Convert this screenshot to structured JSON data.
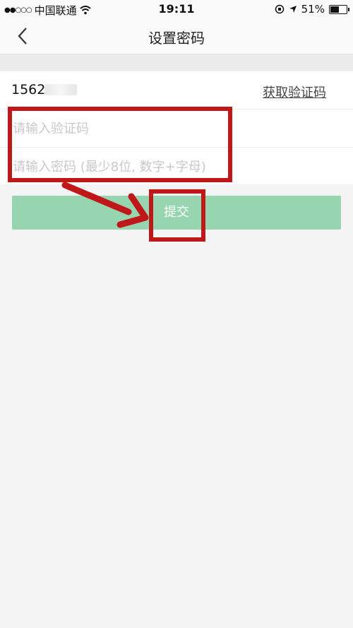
{
  "status_bar": {
    "signal": "●●○○○",
    "carrier": "中国联通",
    "time": "19:11",
    "battery_percent": "51%",
    "battery_level": 0.51
  },
  "nav": {
    "title": "设置密码",
    "back_icon": "chevron-left-icon"
  },
  "form": {
    "phone_value": "1562",
    "get_code_label": "获取验证码",
    "code_placeholder": "请输入验证码",
    "password_placeholder": "请输入密码 (最少8位, 数字+字母)"
  },
  "submit_label": "提交",
  "colors": {
    "accent": "#97d4b0",
    "annotation": "#c01818",
    "background": "#f4f4f4"
  }
}
